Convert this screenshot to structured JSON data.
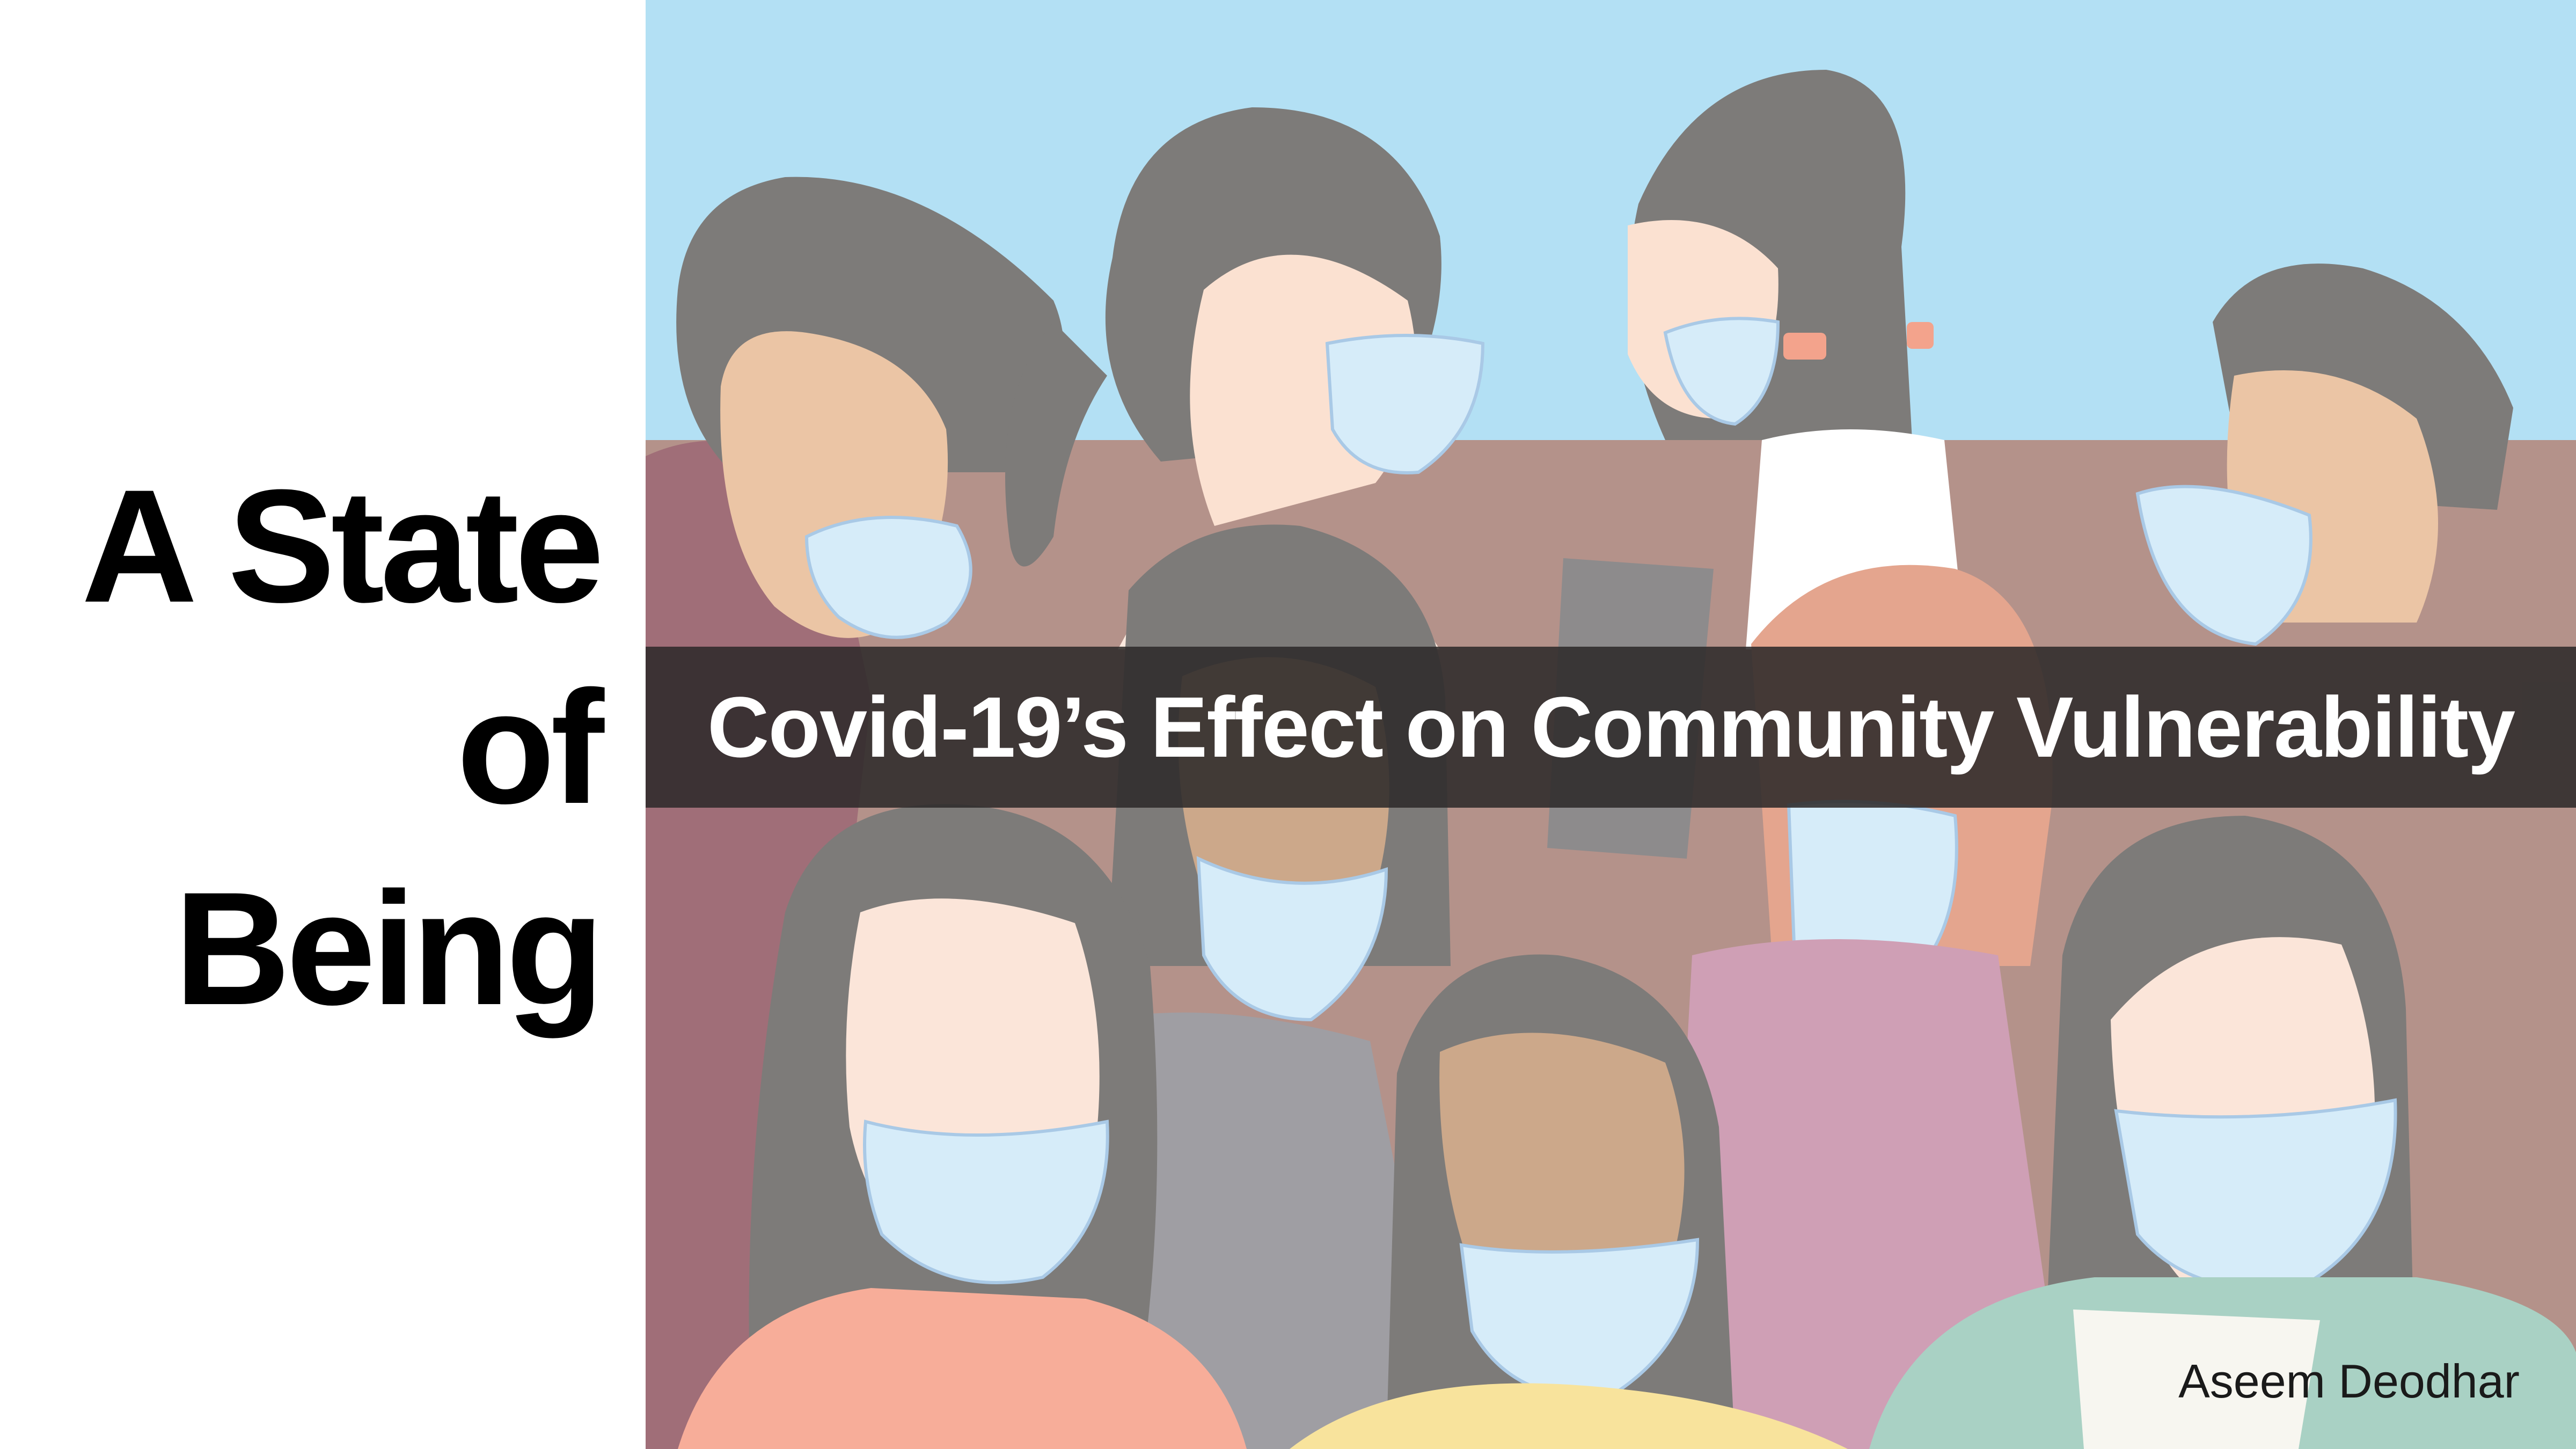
{
  "title": {
    "lines": [
      "A State",
      "of",
      "Being"
    ]
  },
  "subtitle": "Covid-19’s Effect on Community Vulnerability",
  "credit": "Aseem Deodhar",
  "colors": {
    "sky": "#b3e0f4",
    "hair": "#7d7b79",
    "mask": "#d6ecf9",
    "title_text": "#000000",
    "band": "#2d2a2a"
  },
  "illustration": {
    "description_icon": "masked-crowd-illustration"
  }
}
